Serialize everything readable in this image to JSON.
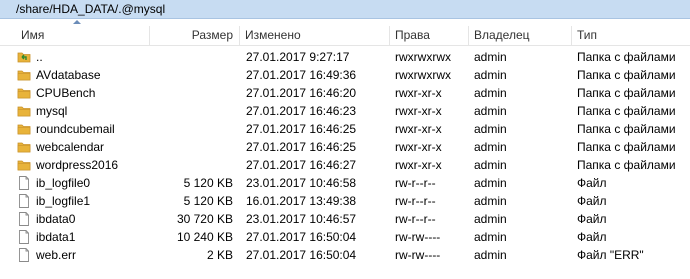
{
  "path": "/share/HDA_DATA/.@mysql",
  "columns": {
    "name": "Имя",
    "size": "Размер",
    "modified": "Изменено",
    "rights": "Права",
    "owner": "Владелец",
    "type": "Тип"
  },
  "rows": [
    {
      "icon": "parent-folder-icon",
      "name": "..",
      "size": "",
      "modified": "27.01.2017 9:27:17",
      "rights": "rwxrwxrwx",
      "owner": "admin",
      "type": "Папка с файлами"
    },
    {
      "icon": "folder-icon",
      "name": "AVdatabase",
      "size": "",
      "modified": "27.01.2017 16:49:36",
      "rights": "rwxrwxrwx",
      "owner": "admin",
      "type": "Папка с файлами"
    },
    {
      "icon": "folder-icon",
      "name": "CPUBench",
      "size": "",
      "modified": "27.01.2017 16:46:20",
      "rights": "rwxr-xr-x",
      "owner": "admin",
      "type": "Папка с файлами"
    },
    {
      "icon": "folder-icon",
      "name": "mysql",
      "size": "",
      "modified": "27.01.2017 16:46:23",
      "rights": "rwxr-xr-x",
      "owner": "admin",
      "type": "Папка с файлами"
    },
    {
      "icon": "folder-icon",
      "name": "roundcubemail",
      "size": "",
      "modified": "27.01.2017 16:46:25",
      "rights": "rwxr-xr-x",
      "owner": "admin",
      "type": "Папка с файлами"
    },
    {
      "icon": "folder-icon",
      "name": "webcalendar",
      "size": "",
      "modified": "27.01.2017 16:46:25",
      "rights": "rwxr-xr-x",
      "owner": "admin",
      "type": "Папка с файлами"
    },
    {
      "icon": "folder-icon",
      "name": "wordpress2016",
      "size": "",
      "modified": "27.01.2017 16:46:27",
      "rights": "rwxr-xr-x",
      "owner": "admin",
      "type": "Папка с файлами"
    },
    {
      "icon": "file-icon",
      "name": "ib_logfile0",
      "size": "5 120 KB",
      "modified": "23.01.2017 10:46:58",
      "rights": "rw-r--r--",
      "owner": "admin",
      "type": "Файл"
    },
    {
      "icon": "file-icon",
      "name": "ib_logfile1",
      "size": "5 120 KB",
      "modified": "16.01.2017 13:49:38",
      "rights": "rw-r--r--",
      "owner": "admin",
      "type": "Файл"
    },
    {
      "icon": "file-icon",
      "name": "ibdata0",
      "size": "30 720 KB",
      "modified": "23.01.2017 10:46:57",
      "rights": "rw-r--r--",
      "owner": "admin",
      "type": "Файл"
    },
    {
      "icon": "file-icon",
      "name": "ibdata1",
      "size": "10 240 KB",
      "modified": "27.01.2017 16:50:04",
      "rights": "rw-rw----",
      "owner": "admin",
      "type": "Файл"
    },
    {
      "icon": "file-icon",
      "name": "web.err",
      "size": "2 KB",
      "modified": "27.01.2017 16:50:04",
      "rights": "rw-rw----",
      "owner": "admin",
      "type": "Файл \"ERR\""
    }
  ],
  "colors": {
    "pathbar_bg": "#c7dcf2",
    "folder": "#e8b33a",
    "folder_dark": "#c9922a",
    "parent_arrow": "#2f8a2f"
  }
}
